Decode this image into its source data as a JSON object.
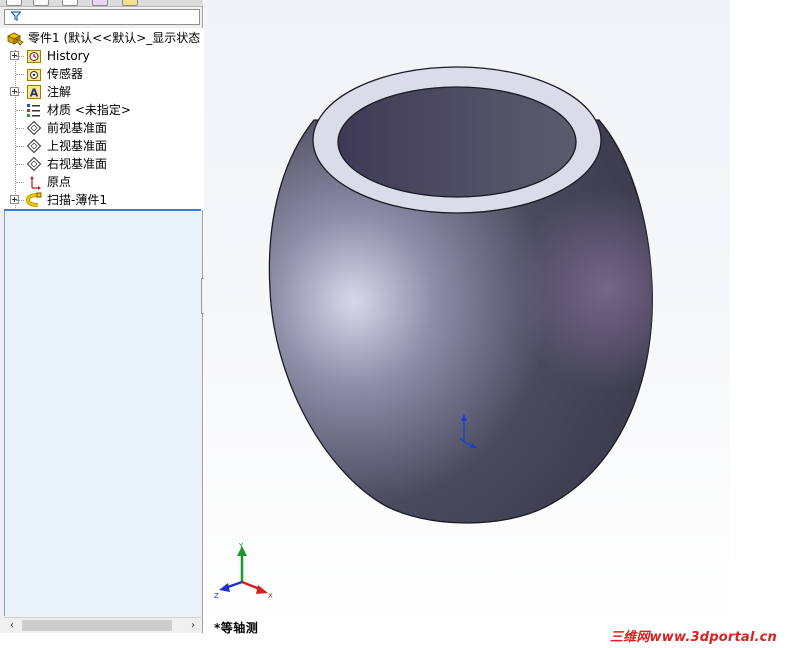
{
  "tree": {
    "root": {
      "label": "零件1  (默认<<默认>_显示状态",
      "icon": "part-icon"
    },
    "items": [
      {
        "label": "History",
        "icon": "history-icon",
        "expandable": true
      },
      {
        "label": "传感器",
        "icon": "sensor-folder-icon",
        "expandable": false
      },
      {
        "label": "注解",
        "icon": "annotation-icon",
        "expandable": true
      },
      {
        "label": "材质 <未指定>",
        "icon": "material-icon",
        "expandable": false
      },
      {
        "label": "前视基准面",
        "icon": "plane-icon",
        "expandable": false
      },
      {
        "label": "上视基准面",
        "icon": "plane-icon",
        "expandable": false
      },
      {
        "label": "右视基准面",
        "icon": "plane-icon",
        "expandable": false
      },
      {
        "label": "原点",
        "icon": "origin-icon",
        "expandable": false
      },
      {
        "label": "扫描-薄件1",
        "icon": "sweep-feature-icon",
        "expandable": true
      }
    ]
  },
  "viewport": {
    "view_label": "*等轴测",
    "triad_axes": {
      "x": "X",
      "y": "Y",
      "z": "Z"
    },
    "colors": {
      "x_axis": "#d42020",
      "y_axis": "#1a9a2a",
      "z_axis": "#2030d0",
      "origin": "#1a3fd0"
    }
  },
  "watermark": "三维网www.3dportal.cn"
}
